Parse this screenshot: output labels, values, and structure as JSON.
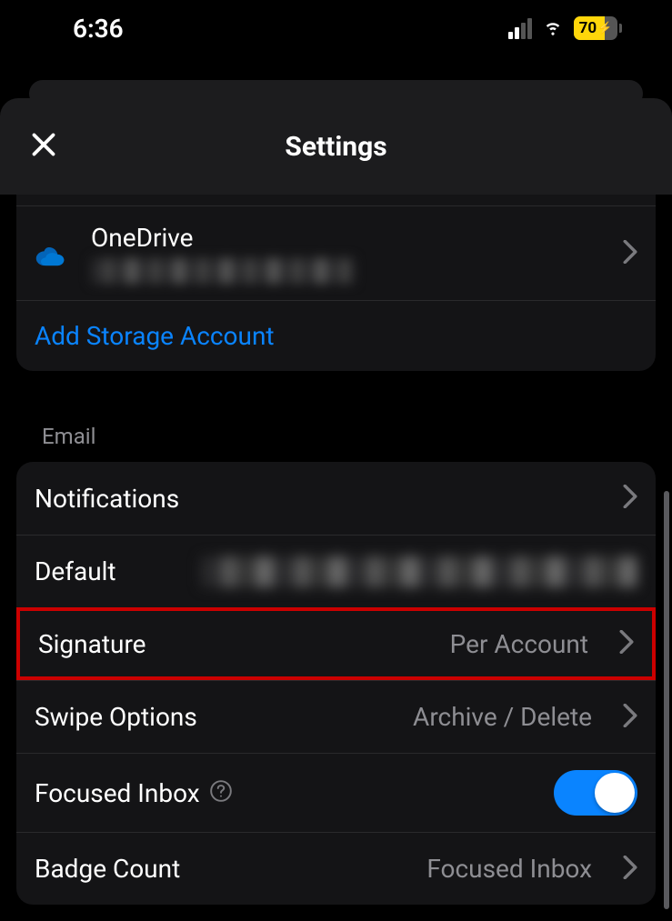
{
  "status": {
    "time": "6:36",
    "battery": "70"
  },
  "header": {
    "title": "Settings"
  },
  "storage": {
    "account": {
      "name": "OneDrive"
    },
    "addLink": "Add Storage Account"
  },
  "emailSection": {
    "title": "Email",
    "notifications": "Notifications",
    "default": "Default",
    "signature": {
      "label": "Signature",
      "value": "Per Account"
    },
    "swipe": {
      "label": "Swipe Options",
      "value": "Archive / Delete"
    },
    "focused": {
      "label": "Focused Inbox"
    },
    "badge": {
      "label": "Badge Count",
      "value": "Focused Inbox"
    }
  }
}
